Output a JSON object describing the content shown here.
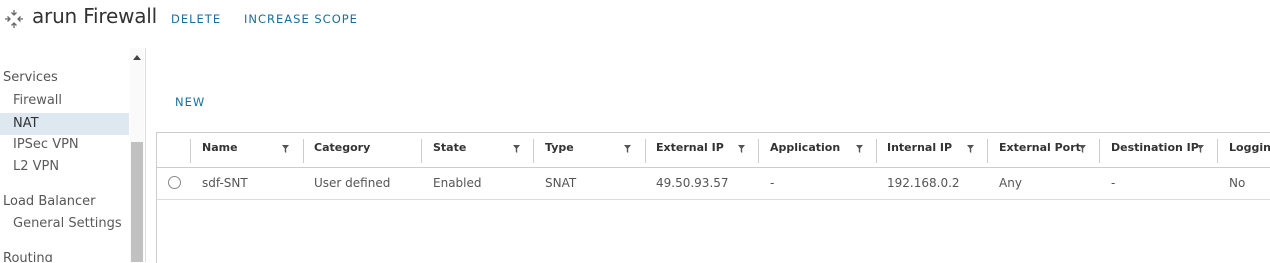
{
  "header": {
    "title": "arun Firewall",
    "delete_label": "DELETE",
    "increase_scope_label": "INCREASE SCOPE",
    "logo_icon": "nsx-edge-icon"
  },
  "sidebar": {
    "sections": [
      {
        "title": "Services",
        "items": [
          "Firewall",
          "NAT",
          "IPSec VPN",
          "L2 VPN"
        ]
      },
      {
        "title": "Load Balancer",
        "items": [
          "General Settings"
        ]
      },
      {
        "title": "Routing",
        "items": []
      }
    ],
    "active_item": "NAT"
  },
  "nat": {
    "new_label": "NEW",
    "columns": [
      "Name",
      "Category",
      "State",
      "Type",
      "External IP",
      "Application",
      "Internal IP",
      "External Port",
      "Destination IP",
      "Logging"
    ],
    "rows": [
      {
        "name": "sdf-SNT",
        "category": "User defined",
        "state": "Enabled",
        "type": "SNAT",
        "external_ip": "49.50.93.57",
        "application": "-",
        "internal_ip": "192.168.0.2",
        "external_port": "Any",
        "destination_ip": "-",
        "logging": "No"
      }
    ]
  },
  "colors": {
    "accent": "#1a6f99",
    "active_bg": "#dde8f0"
  }
}
